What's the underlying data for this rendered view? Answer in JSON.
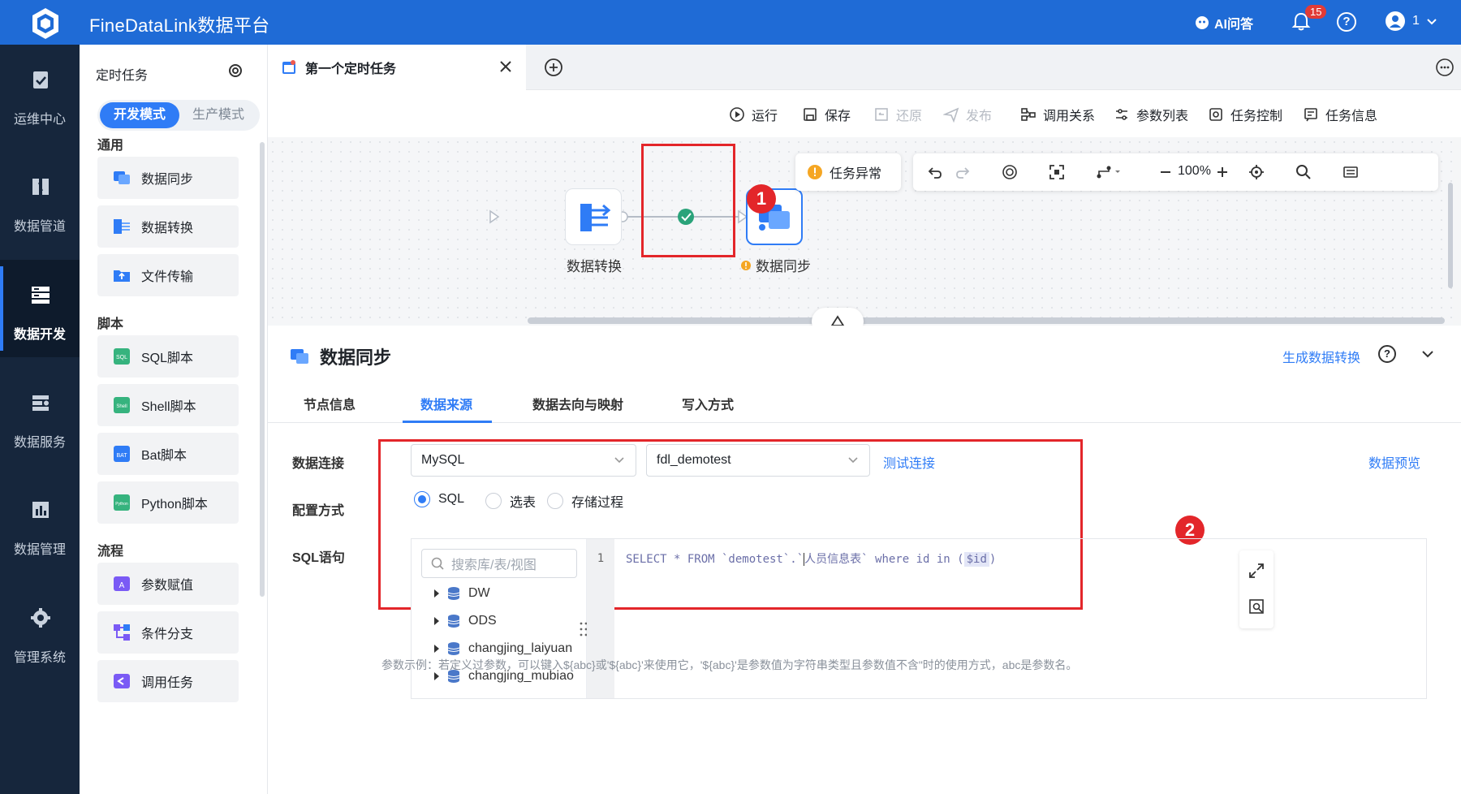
{
  "header": {
    "app_title": "FineDataLink数据平台",
    "ai_label": "AI问答",
    "notification_count": "15",
    "user_label": "1"
  },
  "rail": {
    "items": [
      {
        "label": "运维中心",
        "icon": "clipboard-check-icon"
      },
      {
        "label": "数据管道",
        "icon": "pipeline-icon"
      },
      {
        "label": "数据开发",
        "icon": "server-stack-icon"
      },
      {
        "label": "数据服务",
        "icon": "service-icon"
      },
      {
        "label": "数据管理",
        "icon": "chart-book-icon"
      },
      {
        "label": "管理系统",
        "icon": "gear-icon"
      }
    ],
    "active_index": 2
  },
  "left_panel": {
    "title": "定时任务",
    "mode_dev": "开发模式",
    "mode_prod": "生产模式",
    "section_general": "通用",
    "section_script": "脚本",
    "section_flow": "流程",
    "general_items": [
      "数据同步",
      "数据转换",
      "文件传输"
    ],
    "script_items": [
      "SQL脚本",
      "Shell脚本",
      "Bat脚本",
      "Python脚本"
    ],
    "flow_items": [
      "参数赋值",
      "条件分支",
      "调用任务"
    ]
  },
  "tabs": {
    "active_tab": "第一个定时任务"
  },
  "toolbar": {
    "run": "运行",
    "save": "保存",
    "restore": "还原",
    "publish": "发布",
    "relation": "调用关系",
    "params": "参数列表",
    "control": "任务控制",
    "info": "任务信息"
  },
  "canvas": {
    "warning": "任务异常",
    "zoom": "100%",
    "node1_label": "数据转换",
    "node2_label": "数据同步",
    "marker1": "1",
    "marker2": "2"
  },
  "props": {
    "title": "数据同步",
    "generate_link": "生成数据转换",
    "tabs": [
      "节点信息",
      "数据来源",
      "数据去向与映射",
      "写入方式"
    ],
    "active_tab_index": 1,
    "label_connection": "数据连接",
    "connection_type": "MySQL",
    "connection_db": "fdl_demotest",
    "test_link": "测试连接",
    "preview_link": "数据预览",
    "label_config": "配置方式",
    "radio_options": [
      "SQL",
      "选表",
      "存储过程"
    ],
    "radio_selected": "SQL",
    "label_sql": "SQL语句",
    "tree_search_placeholder": "搜索库/表/视图",
    "tree_items": [
      "DW",
      "ODS",
      "changjing_laiyuan",
      "changjing_mubiao"
    ],
    "line_number": "1",
    "sql_part1": "SELECT * FROM `demotest`.`",
    "sql_part2": "人员信息表",
    "sql_part3": "` where id in (",
    "sql_var": "$id",
    "sql_part4": ")",
    "hint": "参数示例：若定义过参数，可以键入${abc}或'${abc}'来使用它，'${abc}'是参数值为字符串类型且参数值不含\"时的使用方式，abc是参数名。"
  },
  "colors": {
    "brand_blue": "#1f6bd6",
    "accent": "#2f7cf6",
    "rail_bg": "#16263c",
    "annotation_red": "#e3262a"
  }
}
